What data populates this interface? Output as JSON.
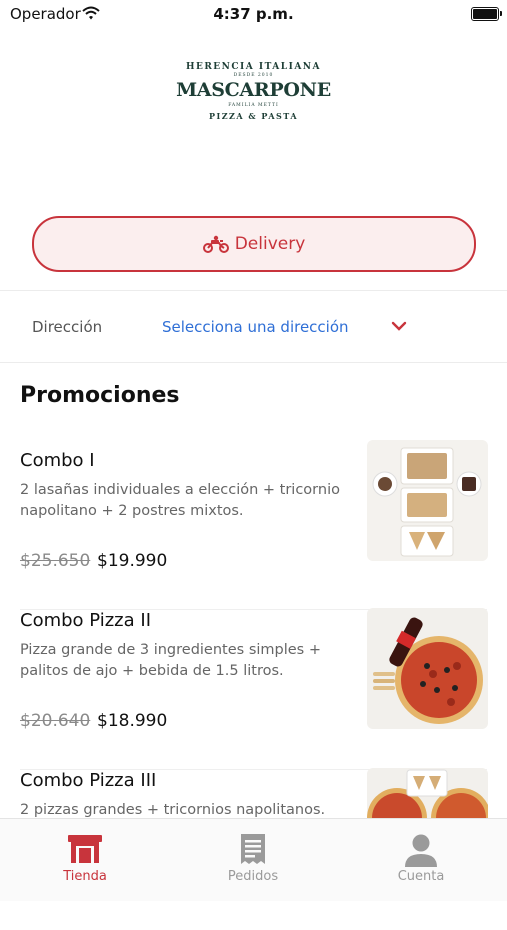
{
  "status_bar": {
    "carrier": "Operador",
    "time": "4:37 p.m."
  },
  "logo": {
    "top": "HERENCIA ITALIANA",
    "since": "DESDE 2010",
    "name": "MASCARPONE",
    "family": "FAMILIA METTI",
    "bottom": "PIZZA & PASTA"
  },
  "delivery": {
    "label": "Delivery",
    "icon": "motorcycle-icon"
  },
  "address": {
    "label": "Dirección",
    "placeholder": "Selecciona una dirección"
  },
  "promotions": {
    "title": "Promociones",
    "items": [
      {
        "name": "Combo I",
        "description": "2 lasañas individuales a elección + tricornio napolitano + 2 postres mixtos.",
        "old_price": "$25.650",
        "price": "$19.990"
      },
      {
        "name": "Combo Pizza II",
        "description": "Pizza grande de 3 ingredientes simples + palitos de ajo + bebida de 1.5 litros.",
        "old_price": "$20.640",
        "price": "$18.990"
      },
      {
        "name": "Combo Pizza III",
        "description": "2 pizzas grandes + tricornios napolitanos."
      }
    ]
  },
  "tabs": [
    {
      "label": "Tienda",
      "icon": "store-icon",
      "active": true
    },
    {
      "label": "Pedidos",
      "icon": "receipt-icon",
      "active": false
    },
    {
      "label": "Cuenta",
      "icon": "user-icon",
      "active": false
    }
  ],
  "colors": {
    "accent": "#c8343c",
    "link": "#2f6fd6",
    "logo": "#1e3e36"
  }
}
